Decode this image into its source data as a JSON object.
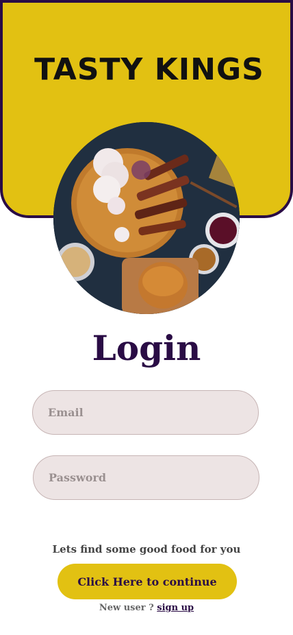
{
  "header": {
    "brand": "TASTY KINGS"
  },
  "hero": {
    "image": "food-platter-image"
  },
  "login": {
    "title": "Login",
    "email_placeholder": "Email",
    "password_placeholder": "Password",
    "tagline": "Lets find some good food for you",
    "continue_label": "Click Here to continue",
    "new_user_text": "New user ? ",
    "signup_label": "sign up"
  },
  "colors": {
    "accent": "#e2c112",
    "primary": "#2a0c45",
    "field_bg": "#ede4e4"
  }
}
